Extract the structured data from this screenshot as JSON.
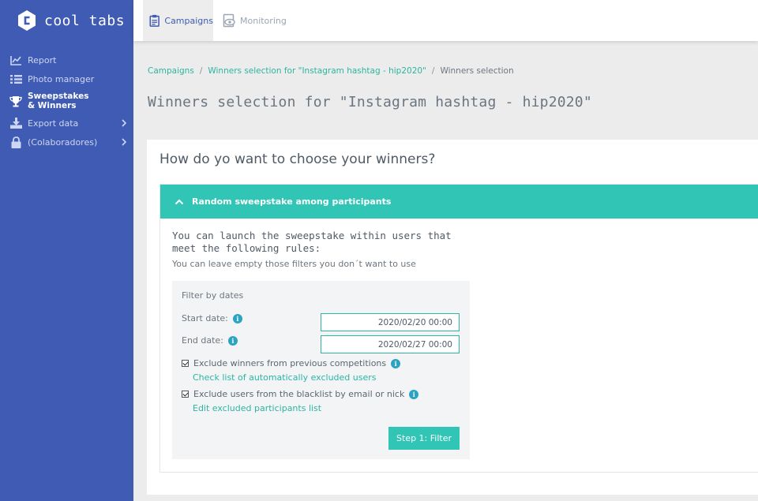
{
  "app": {
    "name": "cool tabs"
  },
  "sidebar": {
    "items": [
      {
        "label": "Report",
        "icon": "chart-line-icon"
      },
      {
        "label": "Photo manager",
        "icon": "list-icon"
      },
      {
        "label": "Sweepstakes & Winners",
        "icon": "trophy-icon",
        "active": true
      },
      {
        "label": "Export data",
        "icon": "download-icon",
        "has_submenu": true
      },
      {
        "label": "(Colaboradores)",
        "icon": "lock-icon",
        "has_submenu": true
      }
    ]
  },
  "topbar": {
    "tabs": [
      {
        "label": "Campaigns",
        "icon": "clipboard-icon",
        "active": true
      },
      {
        "label": "Monitoring",
        "icon": "eye-icon",
        "active": false
      }
    ]
  },
  "breadcrumb": {
    "items": [
      "Campaigns",
      "Winners selection for \"Instagram hashtag - hip2020\"",
      "Winners selection"
    ],
    "separator": "/"
  },
  "page": {
    "title": "Winners selection for \"Instagram hashtag - hip2020\""
  },
  "card": {
    "question": "How do yo want to choose your winners?",
    "panel": {
      "header": "Random sweepstake among participants",
      "intro": "You can launch the sweepstake within users that meet the following rules:",
      "sub": "You can leave empty those filters you don´t want to use",
      "filter": {
        "heading": "Filter by dates",
        "start_label": "Start date:",
        "start_value": "2020/02/20 00:00",
        "end_label": "End date:",
        "end_value": "2020/02/27 00:00",
        "exclude_winners_label": "Exclude winners from previous competitions",
        "exclude_winners_checked": true,
        "exclude_winners_link": "Check list of automatically excluded users",
        "exclude_blacklist_label": "Exclude users from the blacklist by email or nick",
        "exclude_blacklist_checked": true,
        "exclude_blacklist_link": "Edit excluded participants list",
        "submit_label": "Step 1: Filter",
        "info_glyph": "i"
      }
    }
  },
  "colors": {
    "sidebar_bg": "#3f5bb3",
    "accent_teal": "#30c5b5",
    "link_teal": "#2bb5a2",
    "info_blue": "#2aa4c0"
  }
}
